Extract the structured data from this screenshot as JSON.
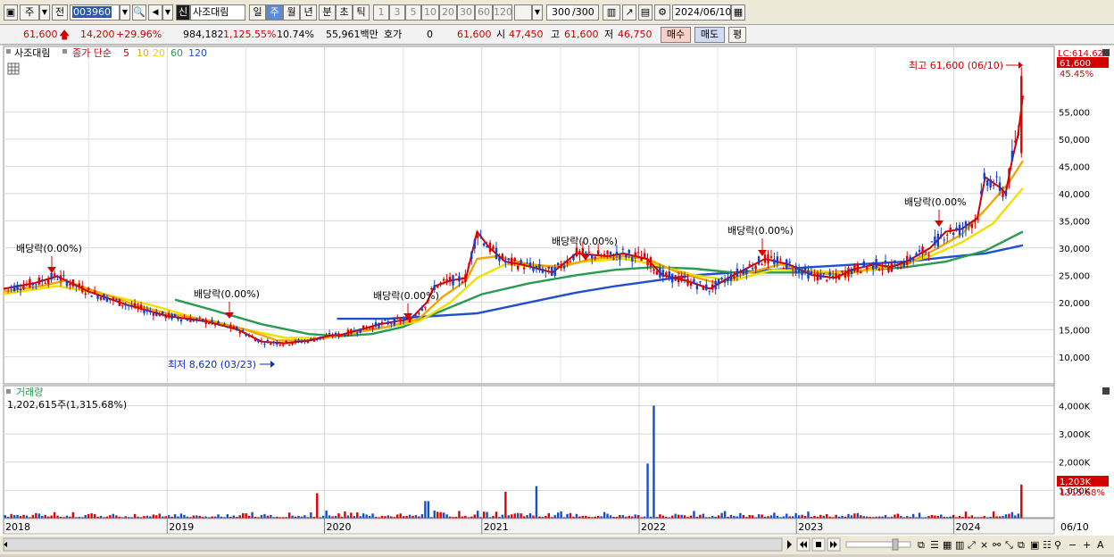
{
  "toolbar": {
    "market_label": "주",
    "prev_label": "전",
    "code_value": "003960",
    "credit_badge": "신",
    "stock_name": "사조대림",
    "periods": [
      "일",
      "주",
      "월",
      "년",
      "분",
      "초",
      "틱"
    ],
    "active_period": "주",
    "intervals": [
      "1",
      "3",
      "5",
      "10",
      "20",
      "30",
      "60",
      "120"
    ],
    "count_value": "300",
    "count_total": "/300",
    "date_value": "2024/06/10"
  },
  "quote": {
    "price": "61,600",
    "change": "14,200",
    "change_pct": "+29.96%",
    "volume": "984,182",
    "volume_ratio": "1,125.55%",
    "turnover": "10.74%",
    "amount": "55,961백만",
    "hoga_label": "호가",
    "hoga_value": "0",
    "hoga_price": "61,600",
    "open_label": "시",
    "open_value": "47,450",
    "high_label": "고",
    "high_value": "61,600",
    "low_label": "저",
    "low_value": "46,750",
    "buy_label": "매수",
    "sell_label": "매도",
    "avg_label": "평"
  },
  "price_panel": {
    "name": "사조대림",
    "legend_prefix": "종가 단순",
    "legend_periods": [
      "5",
      "10",
      "20",
      "60",
      "120"
    ],
    "legend_colors": [
      "#d40000",
      "#f0a800",
      "#f0e000",
      "#2a9a50",
      "#2050d0"
    ],
    "high_note": "최고 61,600 (06/10)",
    "low_note": "최저 8,620 (03/23)",
    "lc_label": "LC:614.62",
    "last_price_tag": "61,600",
    "last_pct_label": "45.45%",
    "dividend_label": "배당락(0.00%)",
    "dividend_label_clipped": "배당락(0.00%"
  },
  "volume_panel": {
    "title": "거래량",
    "value": "1,202,615주(1,315.68%)",
    "last_tag": "1,203K",
    "last_pct": "1315.68%"
  },
  "axis": {
    "date_right": "06/10"
  },
  "chart_data": [
    {
      "type": "candlestick",
      "title": "사조대림",
      "y_ticks": [
        10000,
        15000,
        20000,
        25000,
        30000,
        35000,
        40000,
        45000,
        50000,
        55000
      ],
      "y_tick_labels": [
        "10,000",
        "15,000",
        "20,000",
        "25,000",
        "30,000",
        "35,000",
        "40,000",
        "45,000",
        "50,000",
        "55,000"
      ],
      "ylim": [
        5700,
        62600
      ],
      "x_year_labels": [
        "2018",
        "2019",
        "2020",
        "2021",
        "2022",
        "2023",
        "2024"
      ],
      "x_year_positions": [
        2017.96,
        2019.0,
        2020.0,
        2021.0,
        2022.0,
        2023.0,
        2024.0
      ],
      "xlim": [
        2017.96,
        2024.44
      ],
      "series": [
        {
          "name": "5",
          "color": "#d40000",
          "points": [
            [
              2017.96,
              22500
            ],
            [
              2018.15,
              23500
            ],
            [
              2018.3,
              24800
            ],
            [
              2018.5,
              22000
            ],
            [
              2018.75,
              19500
            ],
            [
              2019.0,
              17500
            ],
            [
              2019.25,
              16500
            ],
            [
              2019.45,
              15000
            ],
            [
              2019.6,
              12800
            ],
            [
              2019.75,
              12500
            ],
            [
              2019.9,
              13000
            ],
            [
              2020.05,
              14000
            ],
            [
              2020.1,
              14000
            ],
            [
              2020.35,
              16000
            ],
            [
              2020.55,
              17000
            ],
            [
              2020.65,
              20000
            ],
            [
              2020.7,
              23000
            ],
            [
              2020.8,
              24000
            ],
            [
              2020.9,
              24500
            ],
            [
              2020.97,
              33000
            ],
            [
              2021.05,
              30000
            ],
            [
              2021.15,
              27500
            ],
            [
              2021.25,
              27000
            ],
            [
              2021.45,
              25500
            ],
            [
              2021.6,
              29000
            ],
            [
              2021.8,
              28500
            ],
            [
              2021.9,
              29000
            ],
            [
              2022.05,
              28000
            ],
            [
              2022.15,
              25000
            ],
            [
              2022.3,
              24000
            ],
            [
              2022.45,
              22500
            ],
            [
              2022.6,
              25000
            ],
            [
              2022.8,
              28000
            ],
            [
              2022.95,
              27000
            ],
            [
              2023.1,
              25000
            ],
            [
              2023.25,
              24500
            ],
            [
              2023.35,
              26000
            ],
            [
              2023.5,
              27000
            ],
            [
              2023.6,
              26500
            ],
            [
              2023.7,
              27500
            ],
            [
              2023.85,
              30000
            ],
            [
              2023.95,
              33000
            ],
            [
              2024.05,
              33500
            ],
            [
              2024.15,
              35500
            ],
            [
              2024.2,
              43000
            ],
            [
              2024.3,
              41000
            ],
            [
              2024.33,
              40000
            ],
            [
              2024.37,
              46000
            ],
            [
              2024.41,
              51000
            ],
            [
              2024.44,
              58000
            ]
          ]
        },
        {
          "name": "10",
          "color": "#f0a800",
          "points": [
            [
              2017.96,
              22000
            ],
            [
              2018.2,
              23000
            ],
            [
              2018.35,
              24000
            ],
            [
              2018.55,
              22000
            ],
            [
              2018.8,
              19500
            ],
            [
              2019.0,
              18000
            ],
            [
              2019.3,
              16500
            ],
            [
              2019.5,
              15000
            ],
            [
              2019.7,
              13000
            ],
            [
              2019.9,
              13000
            ],
            [
              2020.1,
              14000
            ],
            [
              2020.4,
              15500
            ],
            [
              2020.6,
              17000
            ],
            [
              2020.75,
              21000
            ],
            [
              2020.9,
              24000
            ],
            [
              2020.97,
              28000
            ],
            [
              2021.1,
              28500
            ],
            [
              2021.3,
              27000
            ],
            [
              2021.5,
              26500
            ],
            [
              2021.7,
              28000
            ],
            [
              2021.9,
              28500
            ],
            [
              2022.05,
              28000
            ],
            [
              2022.25,
              25500
            ],
            [
              2022.5,
              23500
            ],
            [
              2022.7,
              25500
            ],
            [
              2022.9,
              27000
            ],
            [
              2023.1,
              25500
            ],
            [
              2023.3,
              25000
            ],
            [
              2023.5,
              26500
            ],
            [
              2023.7,
              27000
            ],
            [
              2023.9,
              30000
            ],
            [
              2024.05,
              32500
            ],
            [
              2024.2,
              37000
            ],
            [
              2024.35,
              42000
            ],
            [
              2024.44,
              46000
            ]
          ]
        },
        {
          "name": "20",
          "color": "#f0e000",
          "points": [
            [
              2017.96,
              21500
            ],
            [
              2018.3,
              23000
            ],
            [
              2018.6,
              21500
            ],
            [
              2018.9,
              19500
            ],
            [
              2019.2,
              17000
            ],
            [
              2019.5,
              15000
            ],
            [
              2019.75,
              13500
            ],
            [
              2020.0,
              13500
            ],
            [
              2020.3,
              15000
            ],
            [
              2020.6,
              16500
            ],
            [
              2020.8,
              20000
            ],
            [
              2020.97,
              24500
            ],
            [
              2021.15,
              27000
            ],
            [
              2021.4,
              26500
            ],
            [
              2021.65,
              27500
            ],
            [
              2021.9,
              28000
            ],
            [
              2022.1,
              27000
            ],
            [
              2022.35,
              25000
            ],
            [
              2022.6,
              24000
            ],
            [
              2022.85,
              26000
            ],
            [
              2023.1,
              25800
            ],
            [
              2023.35,
              25500
            ],
            [
              2023.6,
              26500
            ],
            [
              2023.85,
              28500
            ],
            [
              2024.05,
              31000
            ],
            [
              2024.25,
              34500
            ],
            [
              2024.44,
              41000
            ]
          ]
        },
        {
          "name": "60",
          "color": "#2a9a50",
          "points": [
            [
              2019.05,
              20500
            ],
            [
              2019.3,
              18500
            ],
            [
              2019.6,
              16000
            ],
            [
              2019.9,
              14200
            ],
            [
              2020.1,
              13800
            ],
            [
              2020.3,
              14200
            ],
            [
              2020.5,
              15500
            ],
            [
              2020.75,
              18500
            ],
            [
              2021.0,
              21500
            ],
            [
              2021.3,
              23500
            ],
            [
              2021.6,
              25000
            ],
            [
              2021.85,
              26000
            ],
            [
              2022.1,
              26500
            ],
            [
              2022.35,
              26200
            ],
            [
              2022.6,
              25500
            ],
            [
              2022.85,
              25500
            ],
            [
              2023.1,
              25500
            ],
            [
              2023.4,
              25800
            ],
            [
              2023.7,
              26500
            ],
            [
              2023.95,
              27500
            ],
            [
              2024.2,
              29500
            ],
            [
              2024.44,
              33000
            ]
          ]
        },
        {
          "name": "120",
          "color": "#2050d0",
          "points": [
            [
              2020.08,
              17000
            ],
            [
              2020.4,
              17000
            ],
            [
              2020.7,
              17500
            ],
            [
              2020.97,
              18000
            ],
            [
              2021.3,
              20000
            ],
            [
              2021.6,
              21800
            ],
            [
              2021.85,
              23000
            ],
            [
              2022.1,
              24000
            ],
            [
              2022.35,
              25000
            ],
            [
              2022.6,
              25500
            ],
            [
              2022.85,
              26000
            ],
            [
              2023.1,
              26500
            ],
            [
              2023.4,
              27000
            ],
            [
              2023.7,
              27500
            ],
            [
              2023.95,
              28300
            ],
            [
              2024.2,
              29000
            ],
            [
              2024.44,
              30500
            ]
          ]
        }
      ]
    },
    {
      "type": "bar",
      "title": "거래량",
      "y_ticks": [
        1000000,
        2000000,
        3000000,
        4000000
      ],
      "y_tick_labels": [
        "1,000K",
        "2,000K",
        "3,000K",
        "4,000K"
      ],
      "ylim": [
        0,
        4300000
      ],
      "xlim": [
        2017.96,
        2024.44
      ],
      "spikes": [
        [
          2019.95,
          900000
        ],
        [
          2020.65,
          620000
        ],
        [
          2021.15,
          950000
        ],
        [
          2021.35,
          1150000
        ],
        [
          2022.05,
          1950000
        ],
        [
          2022.1,
          4000000
        ],
        [
          2024.44,
          1202615
        ]
      ]
    }
  ]
}
